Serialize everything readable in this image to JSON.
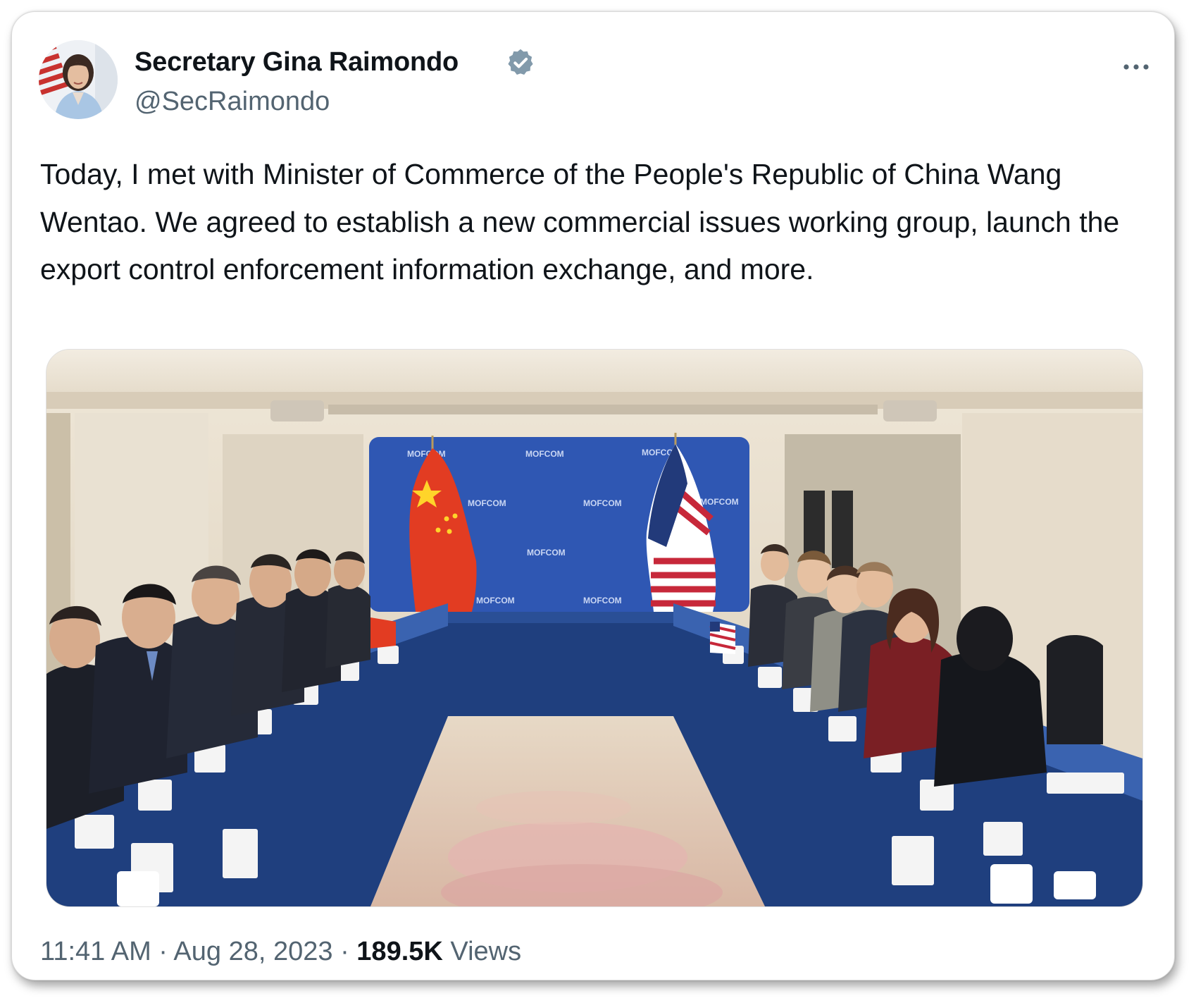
{
  "author": {
    "display_name": "Secretary Gina Raimondo",
    "handle": "@SecRaimondo",
    "verified_icon": "verified-badge-icon",
    "avatar_icon": "profile-photo"
  },
  "more_icon": "more-options-icon",
  "tweet": {
    "text": "Today, I met with Minister of Commerce of the People's Republic of China Wang Wentao. We agreed to establish a new commercial issues working group, launch the export control enforcement information exchange, and more."
  },
  "media": {
    "backdrop_label": "MOFCOM"
  },
  "meta": {
    "time": "11:41 AM",
    "separator": "·",
    "date": "Aug 28, 2023",
    "views_count": "189.5K",
    "views_label": "Views"
  },
  "colors": {
    "text_primary": "#0f1419",
    "text_secondary": "#536471",
    "verified_badge": "#829aab",
    "backdrop_blue": "#2f57b3",
    "table_blue": "#1f3f7e"
  }
}
